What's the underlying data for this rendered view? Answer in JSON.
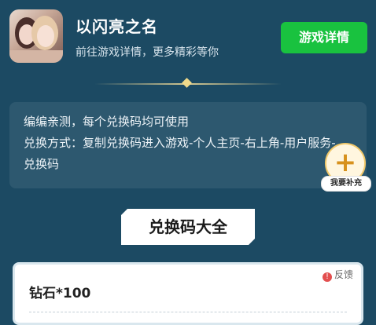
{
  "game": {
    "title": "以闪亮之名",
    "subtitle": "前往游戏详情，更多精彩等你",
    "detail_button": "游戏详情",
    "accent": "#19c23f"
  },
  "notice": {
    "line1": "编编亲测，每个兑换码均可使用",
    "line2": "兑换方式：复制兑换码进入游戏-个人主页-右上角-用户服务-兑换码"
  },
  "add_button": {
    "icon": "plus-icon",
    "label": "我要补充"
  },
  "section": {
    "title": "兑换码大全"
  },
  "codes": [
    {
      "reward": "钻石*100",
      "feedback": "反馈"
    }
  ],
  "colors": {
    "background": "#1c4a63",
    "feedback_icon": "#e34f4f"
  }
}
